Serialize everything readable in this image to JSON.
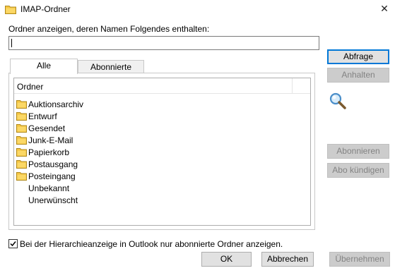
{
  "window": {
    "title": "IMAP-Ordner",
    "close_glyph": "✕",
    "title_icon": "folder-icon"
  },
  "filter": {
    "label": "Ordner anzeigen, deren Namen Folgendes enthalten:",
    "value": ""
  },
  "tabs": [
    {
      "label": "Alle",
      "active": true
    },
    {
      "label": "Abonnierte",
      "active": false
    }
  ],
  "folder_list": {
    "header": "Ordner",
    "items": [
      {
        "label": "Auktionsarchiv",
        "icon": "folder-icon"
      },
      {
        "label": "Entwurf",
        "icon": "folder-icon"
      },
      {
        "label": "Gesendet",
        "icon": "folder-icon"
      },
      {
        "label": "Junk-E-Mail",
        "icon": "folder-icon"
      },
      {
        "label": "Papierkorb",
        "icon": "folder-icon"
      },
      {
        "label": "Postausgang",
        "icon": "folder-icon"
      },
      {
        "label": "Posteingang",
        "icon": "folder-icon"
      },
      {
        "label": "Unbekannt",
        "icon": ""
      },
      {
        "label": "Unerwünscht",
        "icon": ""
      }
    ]
  },
  "side_buttons": {
    "query": "Abfrage",
    "stop": "Anhalten",
    "subscribe": "Abonnieren",
    "unsubscribe": "Abo kündigen"
  },
  "checkbox": {
    "label": "Bei der Hierarchieanzeige in Outlook nur abonnierte Ordner anzeigen.",
    "checked": true
  },
  "footer_buttons": {
    "ok": "OK",
    "cancel": "Abbrechen",
    "apply": "Übernehmen"
  },
  "colors": {
    "folder_yellow": "#f5c542",
    "accent_blue": "#0078d7",
    "disabled_text": "#838383"
  }
}
